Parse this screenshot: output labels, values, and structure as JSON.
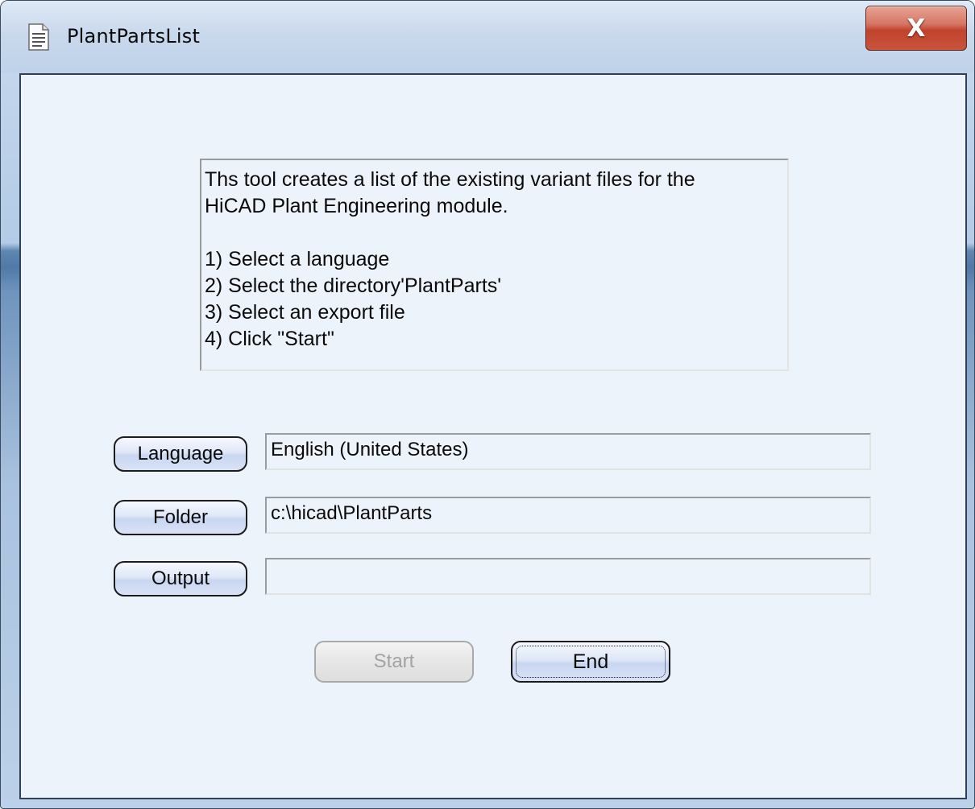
{
  "window": {
    "title": "PlantPartsList",
    "close_label": "X"
  },
  "description": {
    "lines": [
      "Ths tool creates a list of the existing variant files for the",
      "HiCAD Plant Engineering module.",
      "",
      "1) Select a language",
      "2) Select the directory'PlantParts'",
      "3) Select an export file",
      "4) Click \"Start\""
    ]
  },
  "language": {
    "button_label": "Language",
    "value": "English (United States)"
  },
  "folder": {
    "button_label": "Folder",
    "value": "c:\\hicad\\PlantParts"
  },
  "output": {
    "button_label": "Output",
    "value": ""
  },
  "actions": {
    "start_label": "Start",
    "start_enabled": false,
    "end_label": "End"
  },
  "colors": {
    "close_button": "#c8543c",
    "client_background": "#ecf3fb",
    "disabled_text": "#a3a3a3"
  },
  "icons": {
    "title": "document-icon",
    "close": "close-icon"
  }
}
